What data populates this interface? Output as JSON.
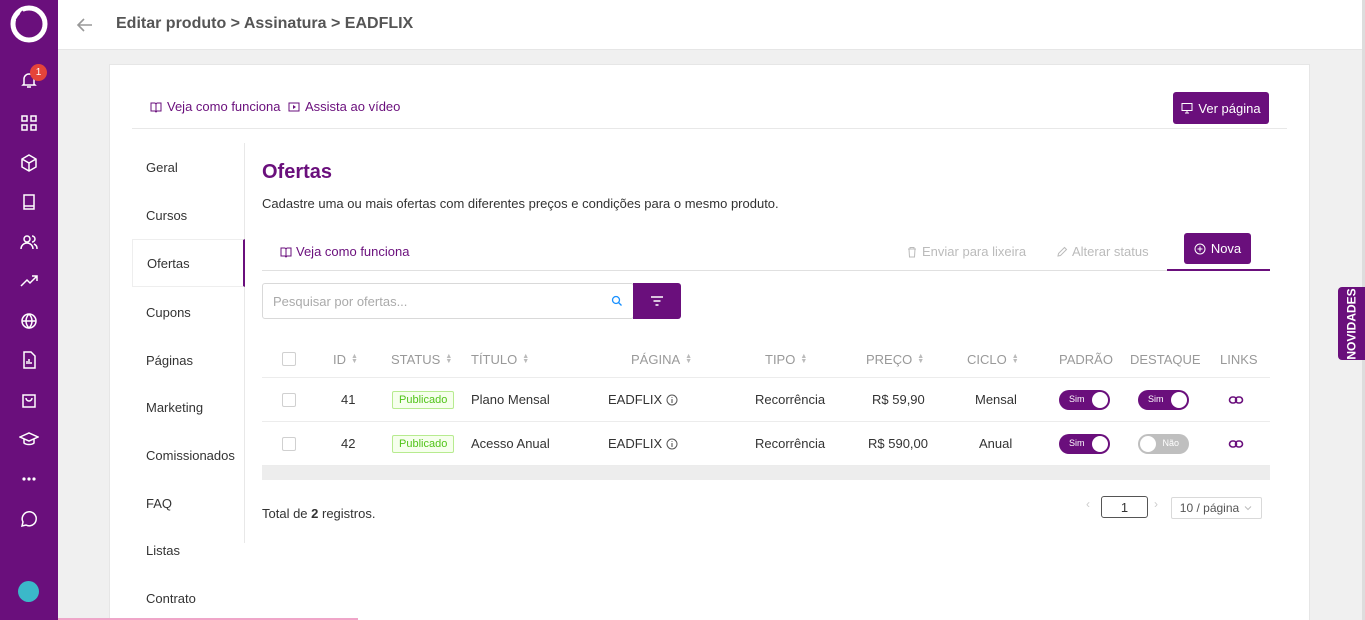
{
  "notifications": {
    "count": "1"
  },
  "header": {
    "breadcrumb": "Editar produto > Assinatura > EADFLIX"
  },
  "side_tab": {
    "label": "NOVIDADES"
  },
  "card_top": {
    "link_how": "Veja como funciona",
    "link_video": "Assista ao vídeo",
    "view_page": "Ver página"
  },
  "menu": {
    "items": [
      {
        "label": "Geral"
      },
      {
        "label": "Cursos"
      },
      {
        "label": "Ofertas"
      },
      {
        "label": "Cupons"
      },
      {
        "label": "Páginas"
      },
      {
        "label": "Marketing"
      },
      {
        "label": "Comissionados"
      },
      {
        "label": "FAQ"
      },
      {
        "label": "Listas"
      },
      {
        "label": "Contrato"
      }
    ],
    "active": "Ofertas"
  },
  "content": {
    "title": "Ofertas",
    "subtitle": "Cadastre uma ou mais ofertas com diferentes preços e condições para o mesmo produto.",
    "how_link": "Veja como funciona",
    "trash": "Enviar para lixeira",
    "change_status": "Alterar status",
    "new_button": "Nova",
    "search_placeholder": "Pesquisar por ofertas..."
  },
  "table": {
    "columns": [
      "ID",
      "STATUS",
      "TÍTULO",
      "PÁGINA",
      "TIPO",
      "PREÇO",
      "CICLO",
      "PADRÃO",
      "DESTAQUE",
      "LINKS"
    ],
    "rows": [
      {
        "id": "41",
        "status": "Publicado",
        "title": "Plano Mensal",
        "page": "EADFLIX",
        "type": "Recorrência",
        "price": "R$ 59,90",
        "cycle": "Mensal",
        "default": "Sim",
        "featured": "Sim"
      },
      {
        "id": "42",
        "status": "Publicado",
        "title": "Acesso Anual",
        "page": "EADFLIX",
        "type": "Recorrência",
        "price": "R$ 590,00",
        "cycle": "Anual",
        "default": "Sim",
        "featured": "Não"
      }
    ]
  },
  "footer": {
    "total_prefix": "Total de ",
    "total_count": "2",
    "total_suffix": " registros.",
    "current_page": "1",
    "page_size": "10 / página"
  },
  "colors": {
    "brand": "#6a0f7c",
    "published": "#52c41a"
  }
}
